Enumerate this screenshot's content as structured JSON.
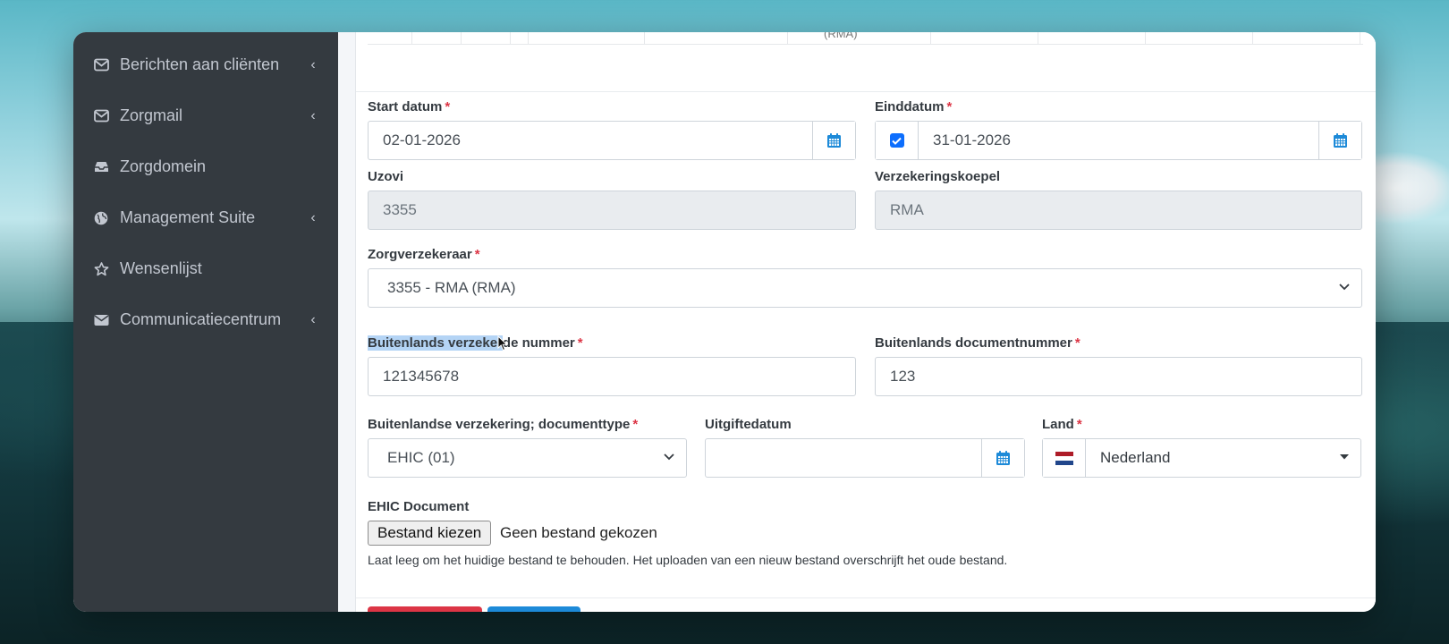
{
  "sidebar": {
    "items": [
      {
        "label": "Berichten aan cliënten",
        "icon": "envelope-outline-icon",
        "has_chevron": true
      },
      {
        "label": "Zorgmail",
        "icon": "envelope-outline-icon",
        "has_chevron": true
      },
      {
        "label": "Zorgdomein",
        "icon": "inbox-icon",
        "has_chevron": false
      },
      {
        "label": "Management Suite",
        "icon": "globe-icon",
        "has_chevron": true
      },
      {
        "label": "Wensenlijst",
        "icon": "star-outline-icon",
        "has_chevron": false
      },
      {
        "label": "Communicatiecentrum",
        "icon": "envelope-solid-icon",
        "has_chevron": true
      }
    ],
    "chevron_glyph": "‹"
  },
  "form": {
    "top_table_fragment": "(RMA)",
    "required_mark": "*",
    "start_date": {
      "label": "Start datum",
      "value": "02-01-2026"
    },
    "end_date": {
      "label": "Einddatum",
      "value": "31-01-2026",
      "checked": true
    },
    "uzovi": {
      "label": "Uzovi",
      "value": "3355"
    },
    "koepel": {
      "label": "Verzekeringskoepel",
      "value": "RMA"
    },
    "zorgverzekeraar": {
      "label": "Zorgverzekeraar",
      "value": "3355 - RMA (RMA)"
    },
    "insured_number": {
      "label_highlighted": "Buitenlands verzeker",
      "label_rest": "de nummer",
      "value": "121345678"
    },
    "document_number": {
      "label": "Buitenlands documentnummer",
      "value": "123"
    },
    "document_type": {
      "label": "Buitenlandse verzekering; documenttype",
      "value": "EHIC (01)"
    },
    "issue_date": {
      "label": "Uitgiftedatum",
      "value": ""
    },
    "country": {
      "label": "Land",
      "value": "Nederland",
      "flag": "netherlands-flag"
    },
    "ehic": {
      "label": "EHIC Document",
      "button": "Bestand kiezen",
      "status": "Geen bestand gekozen",
      "help": "Laat leeg om het huidige bestand te behouden. Het uploaden van een nieuw bestand overschrijft het oude bestand."
    }
  },
  "colors": {
    "sidebar_bg": "#343a40",
    "sidebar_text": "#c2c7d0",
    "required": "#dc3545",
    "accent": "#1d8ad8",
    "danger_button": "#dc3545"
  }
}
